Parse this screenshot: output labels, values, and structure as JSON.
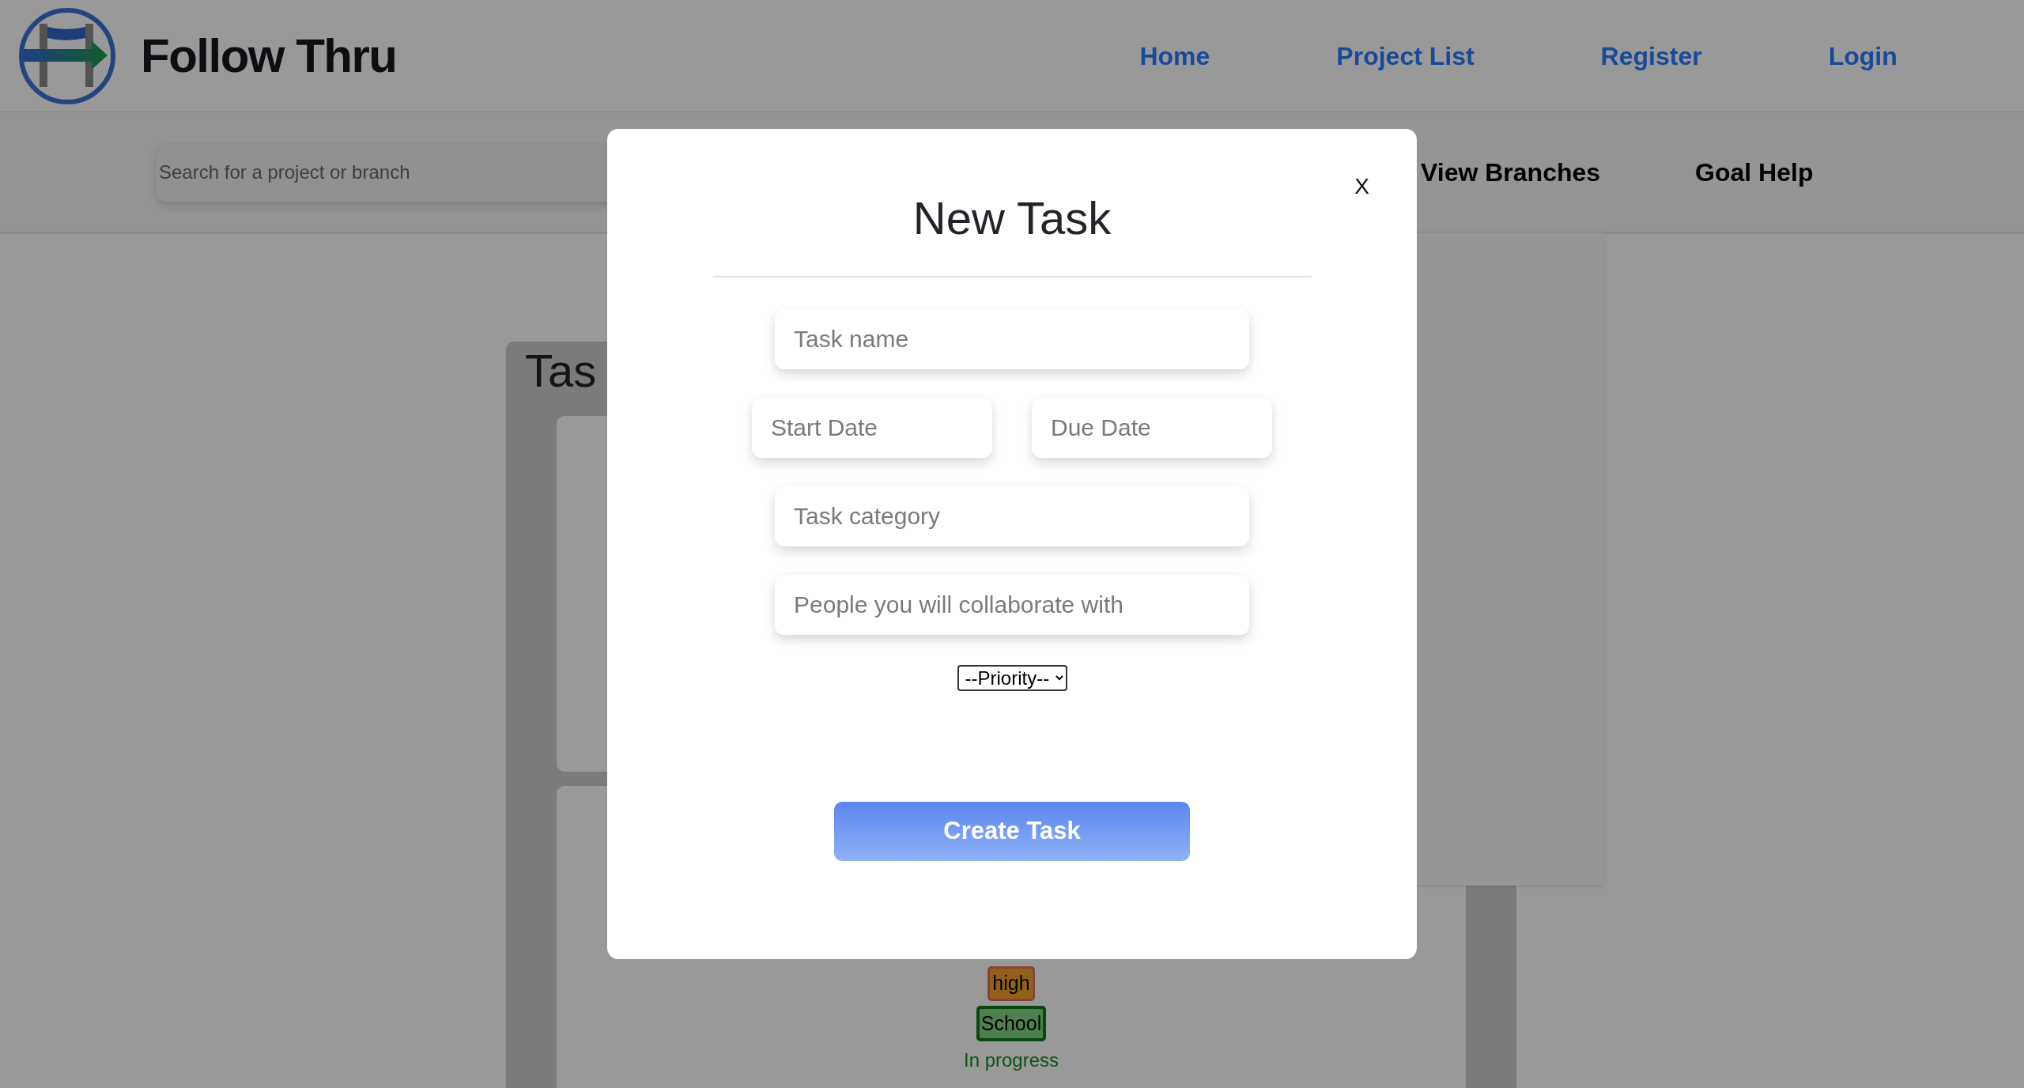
{
  "header": {
    "title": "Follow Thru",
    "nav": [
      {
        "label": "Home"
      },
      {
        "label": "Project List"
      },
      {
        "label": "Register"
      },
      {
        "label": "Login"
      }
    ]
  },
  "subnav": {
    "search": {
      "placeholder": "Search for a project or branch"
    },
    "links": [
      {
        "label": "View Branches"
      },
      {
        "label": "Goal Help"
      }
    ]
  },
  "task_panel": {
    "title": "Tas",
    "task": {
      "priority": "high",
      "category": "School",
      "status": "In progress"
    }
  },
  "modal": {
    "close": "X",
    "title": "New Task",
    "rows": [
      [
        {
          "placeholder": "Task name"
        }
      ],
      [
        {
          "placeholder": "Start Date"
        },
        {
          "placeholder": "Due Date"
        }
      ],
      [
        {
          "placeholder": "Task category"
        }
      ],
      [
        {
          "placeholder": "People you will collaborate with"
        }
      ]
    ],
    "priority_select": {
      "value": "--Priority--"
    },
    "submit": "Create Task"
  }
}
